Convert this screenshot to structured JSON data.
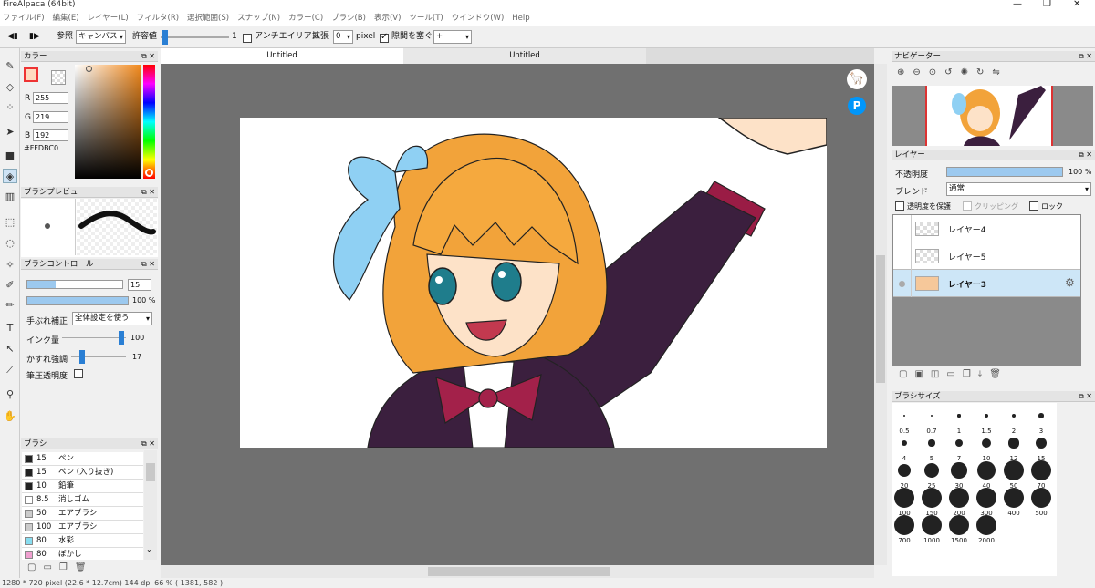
{
  "window": {
    "title": "FireAlpaca (64bit)",
    "controls": [
      "—",
      "❐",
      "✕"
    ]
  },
  "menu": [
    "ファイル(F)",
    "編集(E)",
    "レイヤー(L)",
    "フィルタ(R)",
    "選択範囲(S)",
    "スナップ(N)",
    "カラー(C)",
    "ブラシ(B)",
    "表示(V)",
    "ツール(T)",
    "ウインドウ(W)",
    "Help"
  ],
  "toolbar": {
    "ref_label": "参照",
    "ref_value": "キャンバス",
    "tol_label": "許容値",
    "tol_value": "1",
    "tol_fraction": 0.02,
    "aa_label": "アンチエイリアス",
    "expand_label": "拡張",
    "expand_value": "0",
    "pixel_label": "pixel",
    "gap_label": "隙間を塞ぐ",
    "gap_value": "+"
  },
  "tabs": [
    "Untitled",
    "Untitled"
  ],
  "color": {
    "title": "カラー",
    "r_label": "R",
    "r": "255",
    "g_label": "G",
    "g": "219",
    "b_label": "B",
    "b": "192",
    "hex": "#FFDBC0",
    "fg": "#ffdbc0"
  },
  "brush_preview": {
    "title": "ブラシプレビュー"
  },
  "brush_control": {
    "title": "ブラシコントロール",
    "size": "15",
    "opacity": "100 %",
    "size_fraction": 0.3,
    "stabilizer_label": "手ぶれ補正",
    "stabilizer_value": "全体設定を使う",
    "ink_label": "インク量",
    "ink_value": "100",
    "scatter_label": "かすれ強調",
    "scatter_value": "17",
    "pressure_label": "筆圧透明度"
  },
  "brush_list": {
    "title": "ブラシ",
    "items": [
      {
        "size": "15",
        "name": "ペン",
        "color": "#222222"
      },
      {
        "size": "15",
        "name": "ペン (入り抜き)",
        "color": "#222222"
      },
      {
        "size": "10",
        "name": "鉛筆",
        "color": "#222222"
      },
      {
        "size": "8.5",
        "name": "消しゴム",
        "color": "#ffffff"
      },
      {
        "size": "50",
        "name": "エアブラシ",
        "color": "#cccccc"
      },
      {
        "size": "100",
        "name": "エアブラシ",
        "color": "#cccccc"
      },
      {
        "size": "80",
        "name": "水彩",
        "color": "#88ddf0"
      },
      {
        "size": "80",
        "name": "ぼかし",
        "color": "#f0a0d0"
      }
    ]
  },
  "navigator": {
    "title": "ナビゲーター"
  },
  "layers": {
    "title": "レイヤー",
    "opacity_label": "不透明度",
    "opacity_value": "100 %",
    "blend_label": "ブレンド",
    "blend_value": "通常",
    "protect_label": "透明度を保護",
    "clip_label": "クリッピング",
    "lock_label": "ロック",
    "items": [
      {
        "name": "レイヤー4",
        "active": false
      },
      {
        "name": "レイヤー5",
        "active": false
      },
      {
        "name": "レイヤー3",
        "active": true
      }
    ]
  },
  "brush_sizes": {
    "title": "ブラシサイズ",
    "items": [
      "0.5",
      "0.7",
      "1",
      "1.5",
      "2",
      "3",
      "4",
      "5",
      "7",
      "10",
      "12",
      "15",
      "20",
      "25",
      "30",
      "40",
      "50",
      "70",
      "100",
      "150",
      "200",
      "300",
      "400",
      "500",
      "700",
      "1000",
      "1500",
      "2000"
    ]
  },
  "status": "1280 * 720 pixel  (22.6 * 12.7cm)  144 dpi  66 %  ( 1381, 582 )"
}
